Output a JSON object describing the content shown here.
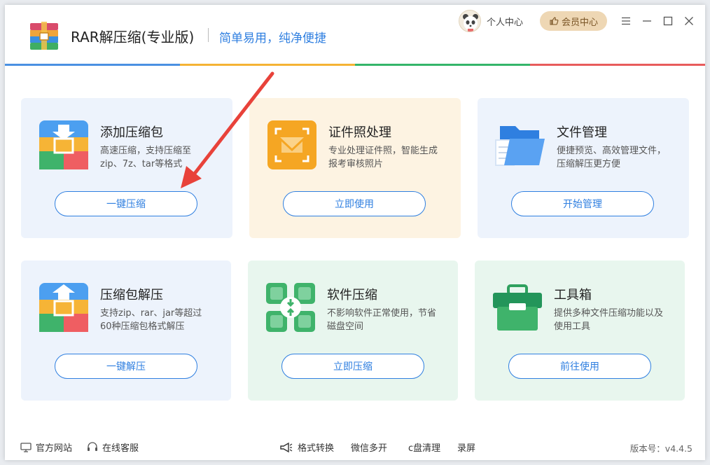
{
  "app": {
    "title": "RAR解压缩(专业版)",
    "slogan": "简单易用，纯净便捷"
  },
  "header": {
    "user_center": "个人中心",
    "vip_center": "会员中心"
  },
  "colors": {
    "primary": "#2f7fe0",
    "bar": [
      "#4a90e2",
      "#f5b335",
      "#35b56a",
      "#e85c5c"
    ]
  },
  "cards": [
    {
      "title": "添加压缩包",
      "desc": "高速压缩，支持压缩至zip、7z、tar等格式",
      "button": "一键压缩"
    },
    {
      "title": "证件照处理",
      "desc": "专业处理证件照，智能生成报考审核照片",
      "button": "立即使用"
    },
    {
      "title": "文件管理",
      "desc": "便捷预览、高效管理文件，压缩解压更方便",
      "button": "开始管理"
    },
    {
      "title": "压缩包解压",
      "desc": "支持zip、rar、jar等超过60种压缩包格式解压",
      "button": "一键解压"
    },
    {
      "title": "软件压缩",
      "desc": "不影响软件正常使用，节省磁盘空间",
      "button": "立即压缩"
    },
    {
      "title": "工具箱",
      "desc": "提供多种文件压缩功能以及使用工具",
      "button": "前往使用"
    }
  ],
  "footer": {
    "website": "官方网站",
    "support": "在线客服",
    "format_convert": "格式转换",
    "wechat_multi": "微信多开",
    "c_clean": "c盘清理",
    "record": "录屏",
    "version": "版本号：v4.4.5"
  }
}
